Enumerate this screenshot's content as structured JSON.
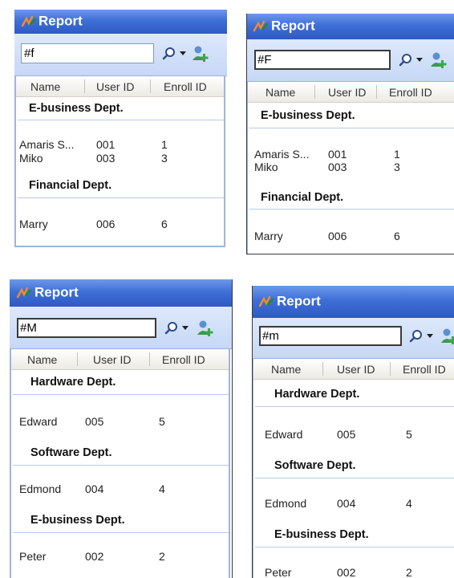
{
  "app": {
    "title": "Report"
  },
  "columns": [
    "Name",
    "User ID",
    "Enroll ID"
  ],
  "panels": [
    {
      "search_value": "#f",
      "groups": [
        {
          "name": "E-business Dept.",
          "rows": [
            [
              "Amaris S...",
              "001",
              "1"
            ],
            [
              "Miko",
              "003",
              "3"
            ]
          ]
        },
        {
          "name": "Financial Dept.",
          "rows": [
            [
              "Marry",
              "006",
              "6"
            ]
          ]
        }
      ]
    },
    {
      "search_value": "#F",
      "groups": [
        {
          "name": "E-business Dept.",
          "rows": [
            [
              "Amaris S...",
              "001",
              "1"
            ],
            [
              "Miko",
              "003",
              "3"
            ]
          ]
        },
        {
          "name": "Financial Dept.",
          "rows": [
            [
              "Marry",
              "006",
              "6"
            ]
          ]
        }
      ]
    },
    {
      "search_value": "#M",
      "groups": [
        {
          "name": "Hardware Dept.",
          "rows": [
            [
              "Edward",
              "005",
              "5"
            ]
          ]
        },
        {
          "name": "Software Dept.",
          "rows": [
            [
              "Edmond",
              "004",
              "4"
            ]
          ]
        },
        {
          "name": "E-business Dept.",
          "rows": [
            [
              "Peter",
              "002",
              "2"
            ]
          ]
        }
      ]
    },
    {
      "search_value": "#m",
      "groups": [
        {
          "name": "Hardware Dept.",
          "rows": [
            [
              "Edward",
              "005",
              "5"
            ]
          ]
        },
        {
          "name": "Software Dept.",
          "rows": [
            [
              "Edmond",
              "004",
              "4"
            ]
          ]
        },
        {
          "name": "E-business Dept.",
          "rows": [
            [
              "Peter",
              "002",
              "2"
            ]
          ]
        }
      ]
    }
  ]
}
